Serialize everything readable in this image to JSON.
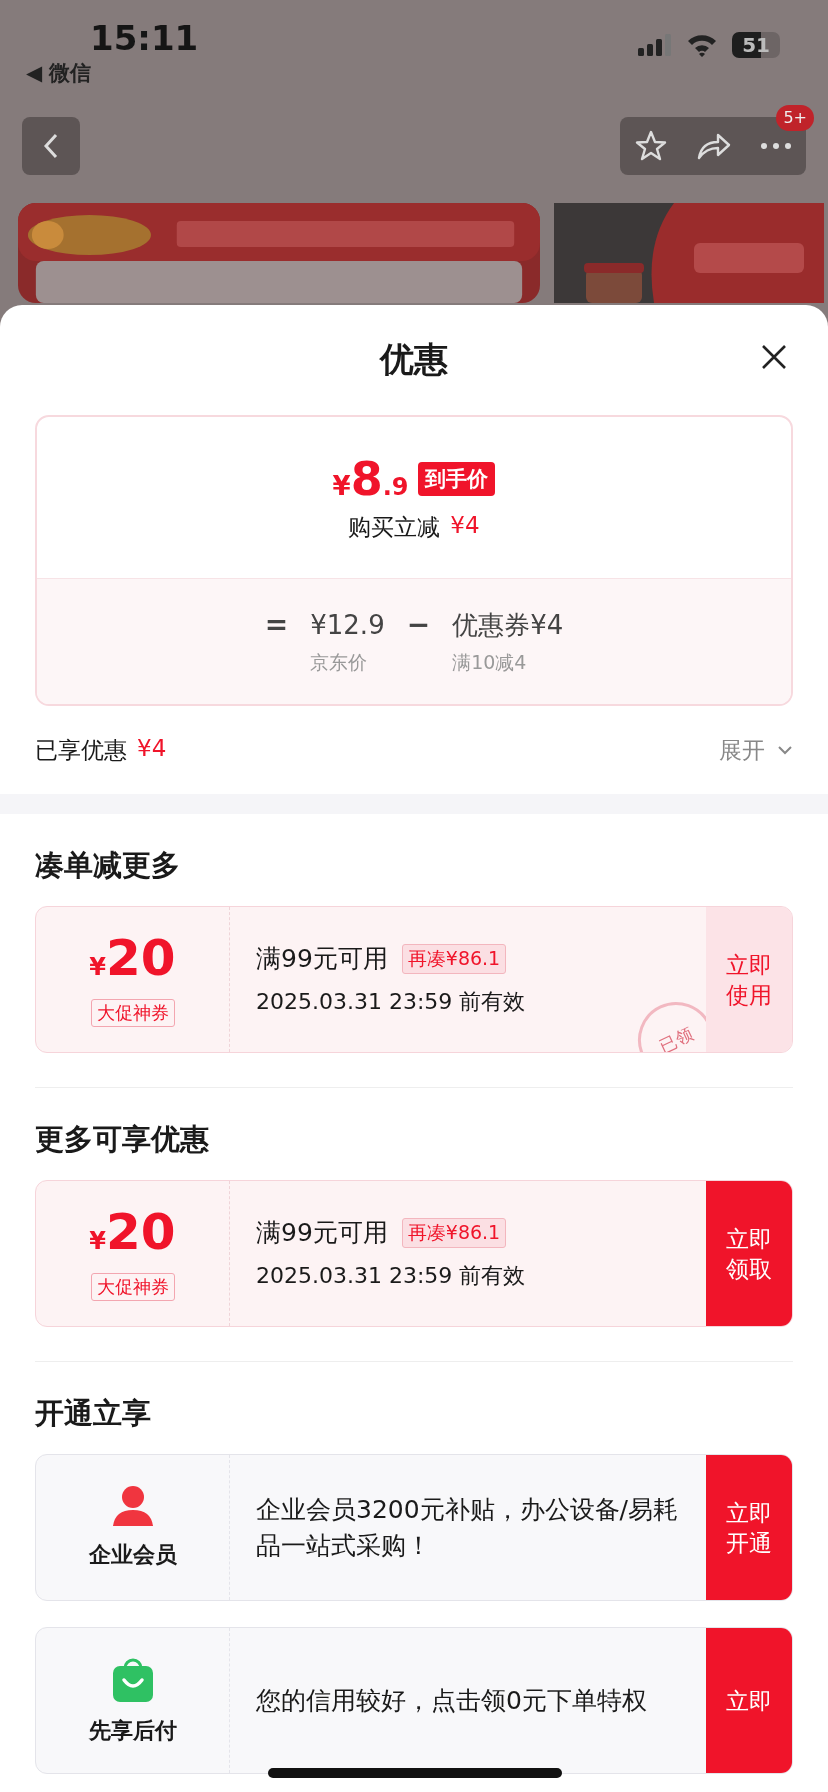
{
  "status_bar": {
    "time": "15:11",
    "back_app": "◀ 微信",
    "battery": "51"
  },
  "nav": {
    "badge": "5+"
  },
  "sheet": {
    "title": "优惠"
  },
  "price_card": {
    "currency": "¥",
    "price_int": "8",
    "price_dec": ".9",
    "price_tag": "到手价",
    "instant_label": "购买立减",
    "instant_amount": "¥4",
    "equals": "=",
    "base_price": "¥12.9",
    "minus": "−",
    "coupon_label": "优惠券¥4",
    "base_caption": "京东价",
    "coupon_caption": "满10减4"
  },
  "savings": {
    "label": "已享优惠",
    "amount": "¥4",
    "toggle": "展开",
    "expanded": false
  },
  "sections": [
    {
      "title": "凑单减更多",
      "cards": [
        {
          "kind": "coupon",
          "currency": "¥",
          "amount": "20",
          "tag": "大促神券",
          "condition": "满99元可用",
          "shortfall": "再凑¥86.1",
          "expiry": "2025.03.31 23:59 前有效",
          "stamp": "已领",
          "action": "立即使用",
          "claimed": true
        }
      ]
    },
    {
      "title": "更多可享优惠",
      "cards": [
        {
          "kind": "coupon",
          "currency": "¥",
          "amount": "20",
          "tag": "大促神券",
          "condition": "满99元可用",
          "shortfall": "再凑¥86.1",
          "expiry": "2025.03.31 23:59 前有效",
          "action": "立即领取",
          "claimed": false
        }
      ]
    },
    {
      "title": "开通立享",
      "cards": [
        {
          "kind": "perk",
          "label": "企业会员",
          "text": "企业会员3200元补贴，办公设备/易耗品一站式采购！",
          "action": "立即开通"
        },
        {
          "kind": "perk",
          "label": "先享后付",
          "text": "您的信用较好，点击领0元下单特权",
          "action": "立即"
        }
      ]
    }
  ]
}
